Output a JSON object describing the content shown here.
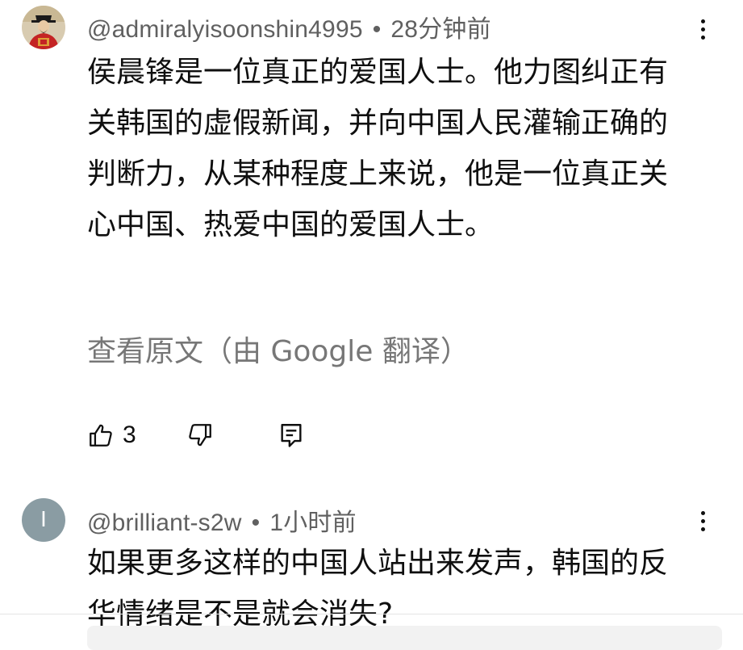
{
  "comments": [
    {
      "author": "@admiralyisoonshin4995",
      "time": "28分钟前",
      "separator": "•",
      "text": "侯晨锋是一位真正的爱国人士。他力图纠正有关韩国的虚假新闻，并向中国人民灌输正确的判断力，从某种程度上来说，他是一位真正关心中国、热爱中国的爱国人士。",
      "translate_link": "查看原文（由 Google 翻译）",
      "like_count": "3",
      "avatar": "portrait-avatar"
    },
    {
      "author": "@brilliant-s2w",
      "time": "1小时前",
      "separator": "•",
      "avatar_letter": "I",
      "avatar_color": "#8a9ca3",
      "text": "如果更多这样的中国人站出来发声，韩国的反华情绪是不是就会消失?"
    }
  ],
  "icons": {
    "like": "thumb-up-outline",
    "dislike": "thumb-down-outline",
    "reply": "comment-outline",
    "more": "vertical-ellipsis"
  }
}
